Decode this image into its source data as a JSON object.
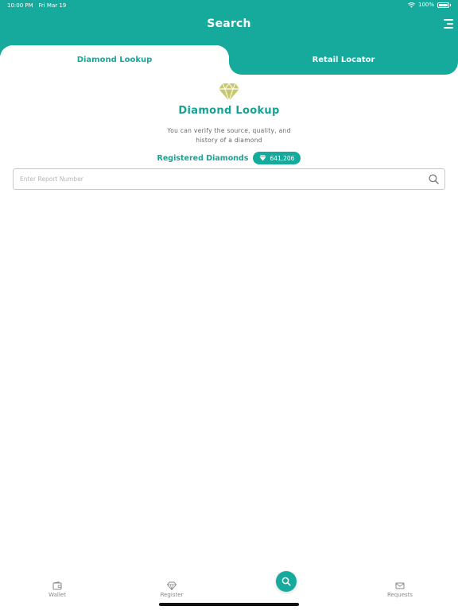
{
  "status_bar": {
    "time": "10:00 PM",
    "date": "Fri Mar 19",
    "battery": "100%"
  },
  "header": {
    "title": "Search"
  },
  "tabs": [
    {
      "label": "Diamond Lookup",
      "active": true
    },
    {
      "label": "Retail Locator",
      "active": false
    }
  ],
  "lookup": {
    "title": "Diamond Lookup",
    "description": "You can verify the source, quality, and history of a diamond",
    "registered_label": "Registered Diamonds",
    "registered_count": "641,206"
  },
  "search": {
    "placeholder": "Enter Report Number",
    "value": ""
  },
  "bottom_nav": [
    {
      "label": "Wallet",
      "icon": "wallet-icon"
    },
    {
      "label": "Register",
      "icon": "diamond-icon"
    },
    {
      "label": "",
      "icon": "search-icon"
    },
    {
      "label": "Requests",
      "icon": "envelope-icon"
    }
  ],
  "colors": {
    "brand": "#15aa9b",
    "logo_gold": "#c8c96e"
  }
}
